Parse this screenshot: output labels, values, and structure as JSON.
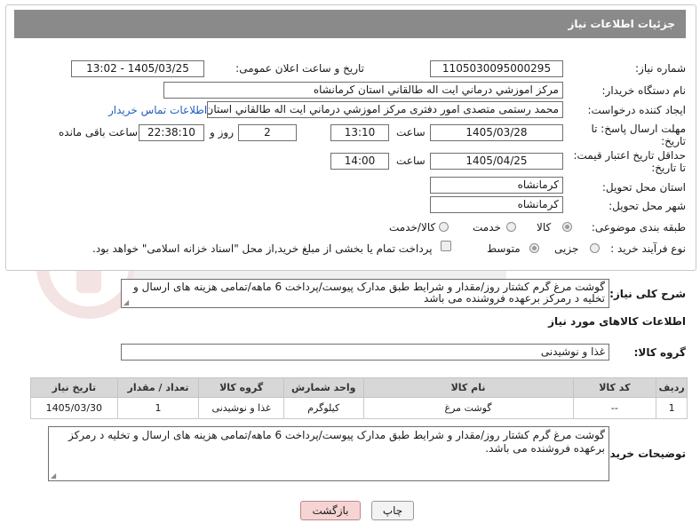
{
  "header": {
    "title": "جزئیات اطلاعات نیاز"
  },
  "form": {
    "need_number_label": "شماره نیاز:",
    "need_number": "1105030095000295",
    "announce_label": "تاریخ و ساعت اعلان عمومی:",
    "announce_value": "1405/03/25 - 13:02",
    "buyer_org_label": "نام دستگاه خریدار:",
    "buyer_org": "مرکز اموزشي درماني ايت اله طالقاني استان کرمانشاه",
    "requester_label": "ایجاد کننده درخواست:",
    "requester": "محمد رستمی متصدی امور دفتری مرکز اموزشي درماني ايت اله طالقاني استان",
    "contact_link": "اطلاعات تماس خریدار",
    "deadline_label_1": "مهلت ارسال پاسخ: تا",
    "deadline_label_2": "تاریخ:",
    "deadline_date": "1405/03/28",
    "time_word": "ساعت",
    "deadline_time": "13:10",
    "days_value": "2",
    "days_word": "روز و",
    "remaining_time": "22:38:10",
    "remaining_word": "ساعت باقی مانده",
    "min_price_label_1": "حداقل تاریخ اعتبار قیمت:",
    "min_price_label_2": "تا تاریخ:",
    "price_date": "1405/04/25",
    "price_time": "14:00",
    "province_label": "استان محل تحویل:",
    "province": "کرمانشاه",
    "city_label": "شهر محل تحویل:",
    "city": "کرمانشاه",
    "category_label": "طبقه بندی موضوعی:",
    "category_options": [
      "کالا",
      "خدمت",
      "کالا/خدمت"
    ],
    "category_selected": "کالا",
    "process_label": "نوع فرآیند خرید :",
    "process_options": [
      "جزیی",
      "متوسط"
    ],
    "process_selected": "متوسط",
    "payment_note": "پرداخت تمام یا بخشی از مبلغ خرید,از محل \"اسناد خزانه اسلامی\" خواهد بود."
  },
  "description": {
    "label": "شرح کلی نیاز:",
    "text": "گوشت مرغ گرم کشتار روز/مقدار و شرایط طبق مدارک پیوست/پرداخت 6 ماهه/تمامی هزینه های ارسال و تخلیه د رمرکز برعهده فروشنده می باشد"
  },
  "goods": {
    "section_title": "اطلاعات کالاهای مورد نیاز",
    "group_label": "گروه کالا:",
    "group_value": "غذا و نوشیدنی",
    "columns": [
      "ردیف",
      "کد کالا",
      "نام کالا",
      "واحد شمارش",
      "گروه کالا",
      "تعداد / مقدار",
      "تاریخ نیاز"
    ],
    "rows": [
      [
        "1",
        "--",
        "گوشت مرغ",
        "کیلوگرم",
        "غذا و نوشیدنی",
        "1",
        "1405/03/30"
      ]
    ]
  },
  "buyer_notes": {
    "label": "توضیحات خریدار:",
    "text": "گوشت مرغ گرم کشتار روز/مقدار و شرایط طبق مدارک پیوست/پرداخت 6 ماهه/تمامی هزینه های ارسال و تخلیه د رمرکز برعهده فروشنده می باشد."
  },
  "buttons": {
    "print": "چاپ",
    "back": "بازگشت"
  },
  "colors": {
    "header_bg": "#8a8a8a",
    "link": "#1f5fc2",
    "back_button_bg": "#f6d4d4"
  }
}
